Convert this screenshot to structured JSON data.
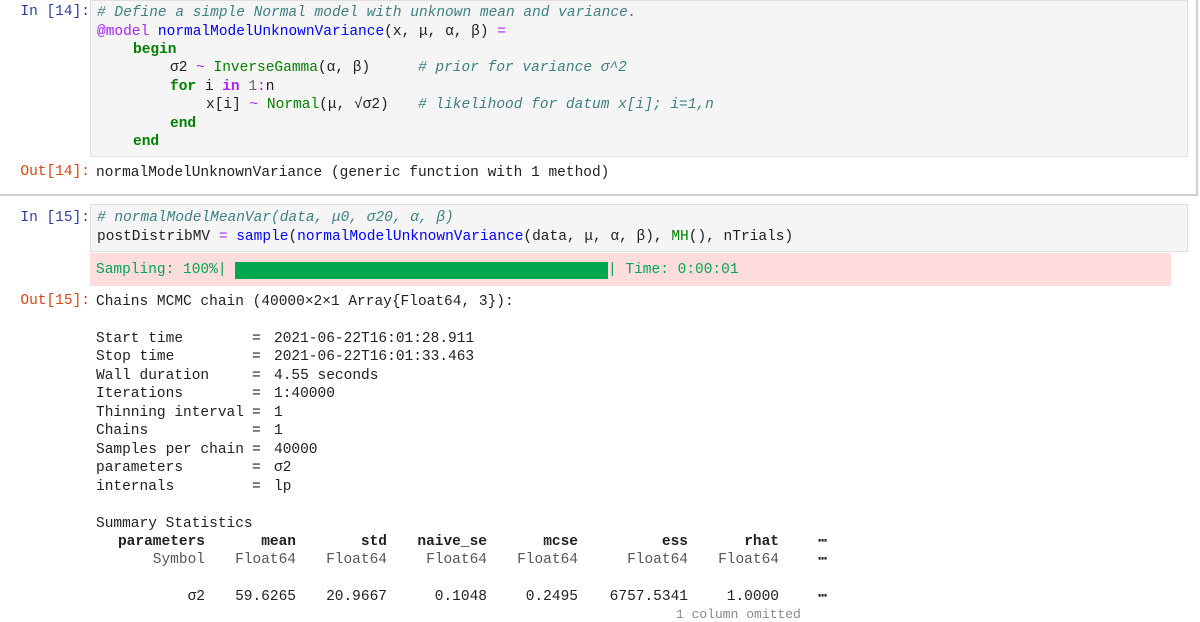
{
  "cell14": {
    "in_prompt": "In [14]:",
    "out_prompt": "Out[14]:",
    "code": {
      "l1": "# Define a simple Normal model with unknown mean and variance.",
      "l2_macro": "@model",
      "l2_fn": "normalModelUnknownVariance",
      "l2_args": "(x, μ, α, β)",
      "l2_eq": "=",
      "l3": "begin",
      "l4_var": "σ2",
      "l4_tilde": "~",
      "l4_dist": "InverseGamma",
      "l4_args": "(α, β)",
      "l4_comment": "# prior for variance σ^2",
      "l5_for": "for",
      "l5_i": "i",
      "l5_in": "in",
      "l5_range": "1",
      "l5_colon": ":",
      "l5_n": "n",
      "l6_x": "x[i]",
      "l6_tilde": "~",
      "l6_dist": "Normal",
      "l6_args": "(μ, √σ2)",
      "l6_comment": "# likelihood for datum x[i]; i=1,n",
      "l7": "end",
      "l8": "end"
    },
    "output": "normalModelUnknownVariance (generic function with 1 method)"
  },
  "cell15": {
    "in_prompt": "In [15]:",
    "out_prompt": "Out[15]:",
    "code": {
      "l1": "# normalModelMeanVar(data, μ0, σ20, α, β)",
      "l2_var": "postDistribMV",
      "l2_eq": "=",
      "l2_fn": "sample",
      "l2_open": "(",
      "l2_model": "normalModelUnknownVariance",
      "l2_margs": "(data, μ, α, β), ",
      "l2_mh": "MH",
      "l2_rest": "(), nTrials)"
    },
    "stderr": {
      "prefix": "Sampling: 100%|",
      "suffix": "| Time: 0:00:01",
      "progress": 1.0
    },
    "output_header": "Chains MCMC chain (40000×2×1 Array{Float64, 3}):",
    "stats": [
      {
        "key": "Start time",
        "value": "2021-06-22T16:01:28.911"
      },
      {
        "key": "Stop time",
        "value": "2021-06-22T16:01:33.463"
      },
      {
        "key": "Wall duration",
        "value": "4.55 seconds"
      },
      {
        "key": "Iterations",
        "value": "1:40000"
      },
      {
        "key": "Thinning interval",
        "value": "1"
      },
      {
        "key": "Chains",
        "value": "1"
      },
      {
        "key": "Samples per chain",
        "value": "40000"
      },
      {
        "key": "parameters",
        "value": "σ2"
      },
      {
        "key": "internals",
        "value": "lp"
      }
    ],
    "summary": {
      "title": "Summary Statistics",
      "headers": [
        "parameters",
        "mean",
        "std",
        "naive_se",
        "mcse",
        "ess",
        "rhat"
      ],
      "types": [
        "Symbol",
        "Float64",
        "Float64",
        "Float64",
        "Float64",
        "Float64",
        "Float64"
      ],
      "row": [
        "σ2",
        "59.6265",
        "20.9667",
        "0.1048",
        "0.2495",
        "6757.5341",
        "1.0000"
      ],
      "ellipsis": "⋯",
      "omitted": "1 column omitted"
    }
  }
}
